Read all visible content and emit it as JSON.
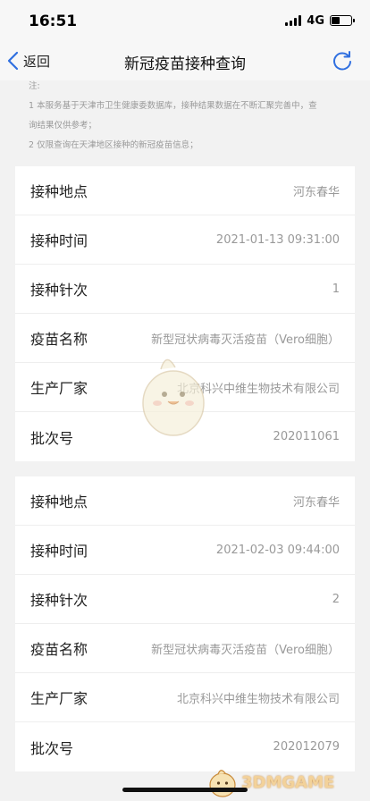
{
  "status_bar": {
    "time": "16:51",
    "network": "4G",
    "battery_level": 0.45
  },
  "nav": {
    "back_label": "返回",
    "title": "新冠疫苗接种查询",
    "refresh_icon": "refresh-icon",
    "back_icon": "chevron-left-icon",
    "accent": "#2f6fe0"
  },
  "notes": {
    "heading": "注:",
    "line1": "1 本服务基于天津市卫生健康委数据库，接种结果数据在不断汇聚完善中，查",
    "line2": "询结果仅供参考；",
    "line3": "2 仅限查询在天津地区接种的新冠疫苗信息；"
  },
  "records": [
    {
      "rows": [
        {
          "label": "接种地点",
          "value": "河东春华"
        },
        {
          "label": "接种时间",
          "value": "2021-01-13 09:31:00"
        },
        {
          "label": "接种针次",
          "value": "1"
        },
        {
          "label": "疫苗名称",
          "value": "新型冠状病毒灭活疫苗（Vero细胞）"
        },
        {
          "label": "生产厂家",
          "value": "北京科兴中维生物技术有限公司"
        },
        {
          "label": "批次号",
          "value": "202011061"
        }
      ]
    },
    {
      "rows": [
        {
          "label": "接种地点",
          "value": "河东春华"
        },
        {
          "label": "接种时间",
          "value": "2021-02-03 09:44:00"
        },
        {
          "label": "接种针次",
          "value": "2"
        },
        {
          "label": "疫苗名称",
          "value": "新型冠状病毒灭活疫苗（Vero细胞）"
        },
        {
          "label": "生产厂家",
          "value": "北京科兴中维生物技术有限公司"
        },
        {
          "label": "批次号",
          "value": "202012079"
        }
      ]
    }
  ],
  "watermark": {
    "brand": "3DMGAME"
  }
}
